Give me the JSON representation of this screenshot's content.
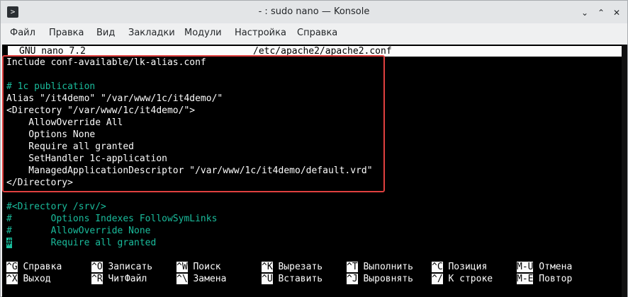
{
  "window": {
    "title": "- : sudo nano — Konsole",
    "app_icon_glyph": ">",
    "minimize_glyph": "⌄",
    "maximize_glyph": "⌃",
    "close_glyph": "✕"
  },
  "menu": [
    "Файл",
    "Правка",
    "Вид",
    "Закладки",
    "Модули",
    "Настройка",
    "Справка"
  ],
  "nano": {
    "version": "GNU nano 7.2",
    "filename": "/etc/apache2/apache2.conf"
  },
  "lines": [
    {
      "text": "Include conf-available/lk-alias.conf",
      "type": "normal"
    },
    {
      "text": "",
      "type": "normal"
    },
    {
      "text": "# 1c publication",
      "type": "comment"
    },
    {
      "text": "Alias \"/it4demo\" \"/var/www/1c/it4demo/\"",
      "type": "normal"
    },
    {
      "text": "<Directory \"/var/www/1c/it4demo/\">",
      "type": "normal"
    },
    {
      "text": "    AllowOverride All",
      "type": "normal"
    },
    {
      "text": "    Options None",
      "type": "normal"
    },
    {
      "text": "    Require all granted",
      "type": "normal"
    },
    {
      "text": "    SetHandler 1c-application",
      "type": "normal"
    },
    {
      "text": "    ManagedApplicationDescriptor \"/var/www/1c/it4demo/default.vrd\"",
      "type": "normal"
    },
    {
      "text": "</Directory>",
      "type": "normal"
    },
    {
      "text": "",
      "type": "normal"
    },
    {
      "text": "#<Directory /srv/>",
      "type": "comment"
    },
    {
      "text": "#       Options Indexes FollowSymLinks",
      "type": "comment"
    },
    {
      "text": "#       AllowOverride None",
      "type": "comment"
    },
    {
      "text": "#       Require all granted",
      "type": "comment-cursor"
    }
  ],
  "shortcuts_row1": [
    {
      "key": "^G",
      "label": "Справка"
    },
    {
      "key": "^O",
      "label": "Записать"
    },
    {
      "key": "^W",
      "label": "Поиск"
    },
    {
      "key": "^K",
      "label": "Вырезать"
    },
    {
      "key": "^T",
      "label": "Выполнить"
    },
    {
      "key": "^C",
      "label": "Позиция"
    },
    {
      "key": "M-U",
      "label": "Отмена"
    }
  ],
  "shortcuts_row2": [
    {
      "key": "^X",
      "label": "Выход"
    },
    {
      "key": "^R",
      "label": "ЧитФайл"
    },
    {
      "key": "^\\",
      "label": "Замена"
    },
    {
      "key": "^U",
      "label": "Вставить"
    },
    {
      "key": "^J",
      "label": "Выровнять"
    },
    {
      "key": "^/",
      "label": "К строке"
    },
    {
      "key": "M-E",
      "label": "Повтор"
    }
  ],
  "colors": {
    "terminal_bg": "#000000",
    "terminal_fg": "#fcfcfc",
    "comment": "#1abc9c",
    "highlight_box": "#e0403f"
  }
}
